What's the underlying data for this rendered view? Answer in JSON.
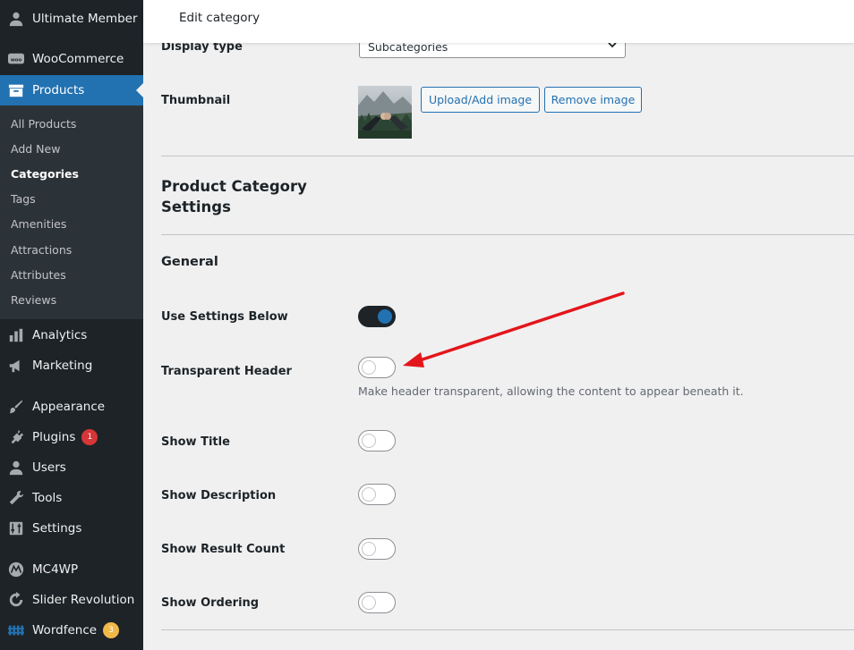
{
  "topbar": {
    "title": "Edit category"
  },
  "sidebar": {
    "items": [
      {
        "label": "Ultimate Member",
        "icon": "user-icon"
      },
      {
        "label": "WooCommerce",
        "icon": "woocommerce-icon"
      },
      {
        "label": "Products",
        "icon": "archive-icon"
      },
      {
        "label": "Analytics",
        "icon": "bar-chart-icon"
      },
      {
        "label": "Marketing",
        "icon": "megaphone-icon"
      },
      {
        "label": "Appearance",
        "icon": "paintbrush-icon"
      },
      {
        "label": "Plugins",
        "icon": "plugin-icon",
        "badge": "1"
      },
      {
        "label": "Users",
        "icon": "user-icon"
      },
      {
        "label": "Tools",
        "icon": "wrench-icon"
      },
      {
        "label": "Settings",
        "icon": "settings-sliders-icon"
      },
      {
        "label": "MC4WP",
        "icon": "mc4wp-icon"
      },
      {
        "label": "Slider Revolution",
        "icon": "refresh-icon"
      },
      {
        "label": "Wordfence",
        "icon": "wordfence-icon",
        "badge": "3"
      }
    ],
    "submenu": [
      "All Products",
      "Add New",
      "Categories",
      "Tags",
      "Amenities",
      "Attractions",
      "Attributes",
      "Reviews"
    ]
  },
  "form": {
    "display_type": {
      "label": "Display type",
      "value": "Subcategories"
    },
    "thumbnail": {
      "label": "Thumbnail",
      "upload_label": "Upload/Add image",
      "remove_label": "Remove image"
    },
    "section_title": "Product Category Settings",
    "general_title": "General",
    "settings": [
      {
        "label": "Use Settings Below",
        "on": true
      },
      {
        "label": "Transparent Header",
        "on": false,
        "description": "Make header transparent, allowing the content to appear beneath it."
      },
      {
        "label": "Show Title",
        "on": false
      },
      {
        "label": "Show Description",
        "on": false
      },
      {
        "label": "Show Result Count",
        "on": false
      },
      {
        "label": "Show Ordering",
        "on": false
      }
    ]
  },
  "colors": {
    "accent": "#2271b1",
    "sidebar_bg": "#1d2327",
    "badge_red": "#d63638",
    "badge_orange": "#f0b849",
    "annotation_arrow": "#e3161b"
  }
}
